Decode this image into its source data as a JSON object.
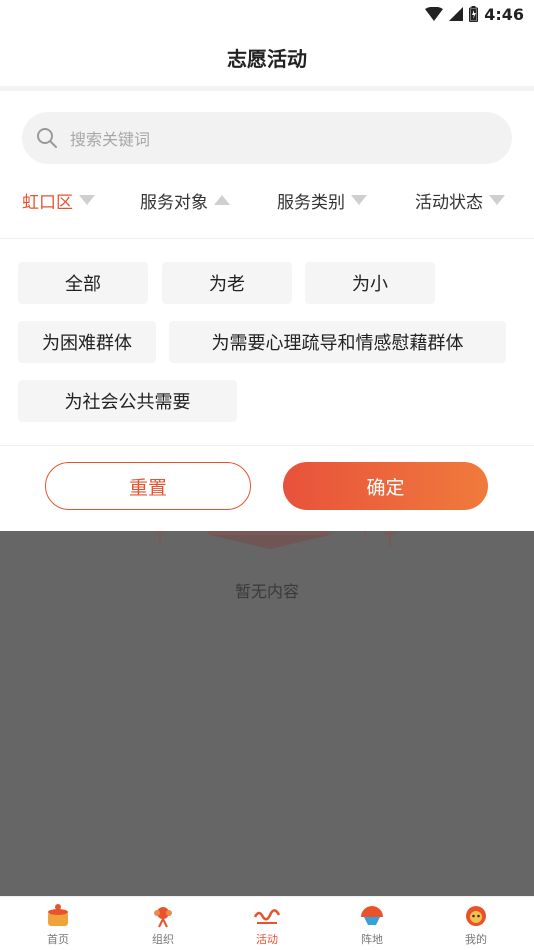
{
  "status_bar": {
    "time": "4:46",
    "icons": [
      "wifi-icon",
      "signal-icon",
      "battery-icon"
    ]
  },
  "header": {
    "title": "志愿活动"
  },
  "search": {
    "placeholder": "搜索关键词",
    "icon": "search-icon"
  },
  "filters": [
    {
      "label": "虹口区",
      "active": true,
      "arrow": "down"
    },
    {
      "label": "服务对象",
      "active": false,
      "arrow": "up"
    },
    {
      "label": "服务类别",
      "active": false,
      "arrow": "down"
    },
    {
      "label": "活动状态",
      "active": false,
      "arrow": "down"
    }
  ],
  "options": [
    "全部",
    "为老",
    "为小",
    "为困难群体",
    "为需要心理疏导和情感慰藉群体",
    "为社会公共需要"
  ],
  "actions": {
    "reset": "重置",
    "confirm": "确定"
  },
  "empty_state": {
    "text": "暂无内容"
  },
  "tab_bar": {
    "tabs": [
      {
        "label": "首页",
        "icon": "home-drum-icon",
        "active": false
      },
      {
        "label": "组织",
        "icon": "organization-knot-icon",
        "active": false
      },
      {
        "label": "活动",
        "icon": "activity-logo-icon",
        "active": true
      },
      {
        "label": "阵地",
        "icon": "position-fan-icon",
        "active": false
      },
      {
        "label": "我的",
        "icon": "profile-lion-icon",
        "active": false
      }
    ]
  },
  "colors": {
    "accent": "#e8532e",
    "overlay": "#666666",
    "chip_bg": "#f5f5f5"
  }
}
